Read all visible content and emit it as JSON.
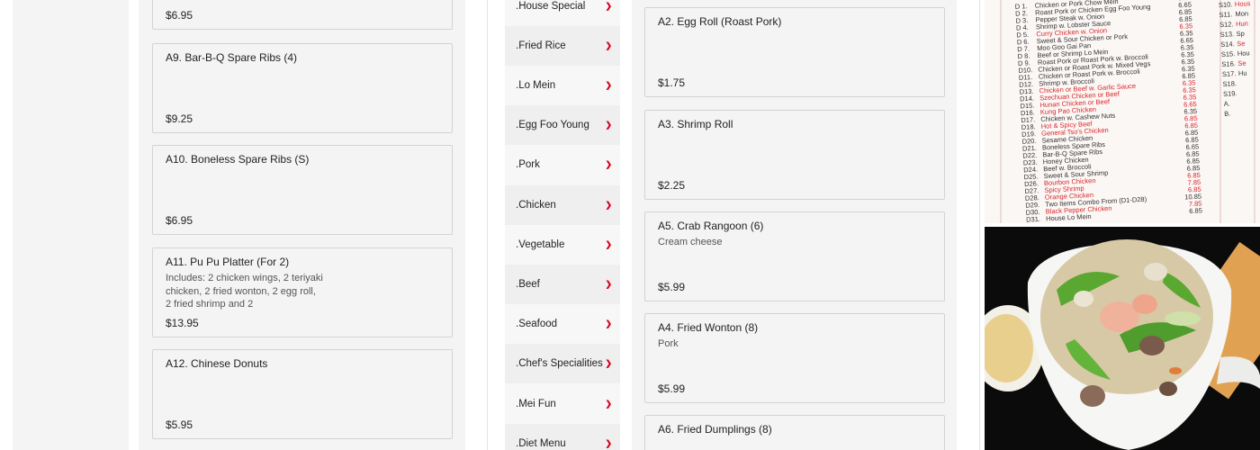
{
  "left_items": [
    {
      "name": "",
      "desc": "",
      "price": "$6.95"
    },
    {
      "name": "A9. Bar-B-Q Spare Ribs (4)",
      "desc": "",
      "price": "$9.25"
    },
    {
      "name": "A10. Boneless Spare Ribs (S)",
      "desc": "",
      "price": "$6.95"
    },
    {
      "name": "A11. Pu Pu Platter (For 2)",
      "desc": "Includes: 2 chicken wings, 2 teriyaki chicken, 2 fried wonton, 2 egg roll, 2 fried shrimp and 2",
      "price": "$13.95"
    },
    {
      "name": "A12. Chinese Donuts",
      "desc": "",
      "price": "$5.95"
    }
  ],
  "categories": [
    ".House Special",
    ".Fried Rice",
    ".Lo Mein",
    ".Egg Foo Young",
    ".Pork",
    ".Chicken",
    ".Vegetable",
    ".Beef",
    ".Seafood",
    ".Chef's Specialities",
    ".Mei Fun",
    ".Diet Menu"
  ],
  "right_items": [
    {
      "name": "A2. Egg Roll (Roast Pork)",
      "desc": "",
      "price": "$1.75"
    },
    {
      "name": "A3. Shrimp Roll",
      "desc": "",
      "price": "$2.25"
    },
    {
      "name": "A5. Crab Rangoon (6)",
      "desc": "Cream cheese",
      "price": "$5.99"
    },
    {
      "name": "A4. Fried Wonton (8)",
      "desc": "Pork",
      "price": "$5.99"
    },
    {
      "name": "A6. Fried Dumplings (8)",
      "desc": "",
      "price": ""
    }
  ],
  "menu_photo": {
    "codes": [
      "D 1.",
      "D 2.",
      "D 3.",
      "D 4.",
      "D 5.",
      "D 6.",
      "D 7.",
      "D 8.",
      "D 9.",
      "D10.",
      "D11.",
      "D12.",
      "D13.",
      "D14.",
      "D15.",
      "D16.",
      "D17.",
      "D18.",
      "D19.",
      "D20.",
      "D21.",
      "D22.",
      "D23.",
      "D24.",
      "D25.",
      "D26.",
      "D27.",
      "D28.",
      "D29.",
      "D30.",
      "D31."
    ],
    "names": [
      "Chicken or Pork Chow Mein",
      "Roast Pork or Chicken Egg Foo Young",
      "Pepper Steak w. Onion",
      "Shrimp w. Lobster Sauce",
      "Curry Chicken w. Onion",
      "Sweet & Sour Chicken or Pork",
      "Moo Goo Gai Pan",
      "Beef or Shrimp Lo Mein",
      "Roast Pork or Roast Pork w. Broccoli",
      "Chicken or Roast Pork w. Mixed Vegs",
      "Chicken or Roast Pork w. Broccoli",
      "Shrimp w. Broccoli",
      "Chicken or Beef w. Garlic Sauce",
      "Szechuan Chicken or Beef",
      "Hunan Chicken or Beef",
      "Kung Pao Chicken",
      "Chicken w. Cashew Nuts",
      "Hot & Spicy Beef",
      "General Tso's Chicken",
      "Sesame Chicken",
      "Boneless Spare Ribs",
      "Bar-B-Q Spare Ribs",
      "Honey Chicken",
      "Beef w. Broccoli",
      "Sweet & Sour Shrimp",
      "Bourbon Chicken",
      "Spicy Shrimp",
      "Orange Chicken",
      "Two Items Combo From (D1-D28)",
      "Black Pepper Chicken",
      "House Lo Mein"
    ],
    "prices": [
      "6.35",
      "6.65",
      "6.85",
      "6.85",
      "6.35",
      "6.35",
      "6.65",
      "6.35",
      "6.35",
      "6.35",
      "6.35",
      "6.85",
      "6.35",
      "6.35",
      "6.35",
      "6.65",
      "6.35",
      "6.85",
      "6.85",
      "6.85",
      "6.85",
      "6.65",
      "6.85",
      "6.85",
      "6.85",
      "6.85",
      "7.85",
      "6.85",
      "10.85",
      "7.85",
      "6.85"
    ],
    "right_codes": [
      "S10.",
      "S11.",
      "S12.",
      "S13.",
      "S14.",
      "S15.",
      "S16.",
      "S17.",
      "S18.",
      "S19.",
      "A.",
      "B."
    ],
    "right_words": [
      "Hous",
      "Mon",
      "Hun",
      "Sp",
      "Se",
      "Hou",
      "Se",
      "Hu"
    ]
  }
}
